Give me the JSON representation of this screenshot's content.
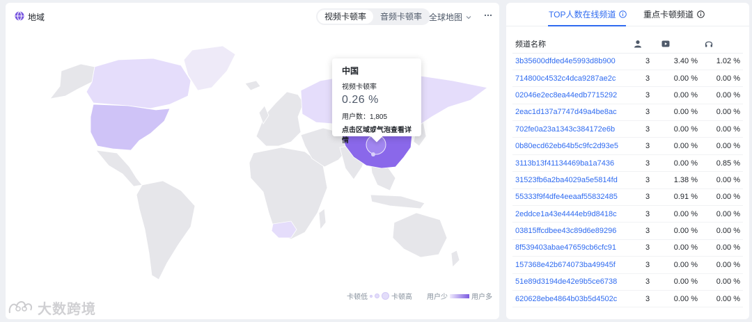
{
  "map_panel": {
    "title": "地域",
    "title_icon": "globe-icon",
    "toggle": {
      "options": [
        "视频卡顿率",
        "音频卡顿率"
      ],
      "selected": "视频卡顿率"
    },
    "map_select": {
      "value": "全球地图",
      "icon": "chevron-down-icon"
    },
    "more_icon": "more-horizontal-icon",
    "tooltip": {
      "country": "中国",
      "metric_label": "视频卡顿率",
      "metric_value": "0.26 %",
      "users_label": "用户数：",
      "users_value": "1,805",
      "hint": "点击区域或气泡查看详情"
    },
    "legend": {
      "stall_low": "卡顿低",
      "stall_high": "卡顿高",
      "users_few": "用户少",
      "users_many": "用户多"
    },
    "highlighted_regions": [
      "China",
      "Russia",
      "United States",
      "Canada",
      "Greenland",
      "South Africa"
    ],
    "colors": {
      "accent": "#2f6bf0",
      "highlight_strong": "#8d6cec",
      "highlight_light": "#d9d0fb",
      "land": "#e6e6ea"
    }
  },
  "watermark": {
    "text": "大数跨境"
  },
  "channel_panel": {
    "tabs": [
      {
        "label": "TOP人数在线频道",
        "active": true,
        "icon": "info-icon"
      },
      {
        "label": "重点卡顿频道",
        "active": false,
        "icon": "info-icon"
      }
    ],
    "columns": {
      "name": "频道名称",
      "users_icon": "user-icon",
      "video_icon": "video-play-icon",
      "audio_icon": "headphones-icon"
    },
    "rows": [
      {
        "name": "3b35600dfded4e5993d8b900",
        "users": "3",
        "video": "3.40 %",
        "audio": "1.02 %"
      },
      {
        "name": "714800c4532c4dca9287ae2c",
        "users": "3",
        "video": "0.00 %",
        "audio": "0.00 %"
      },
      {
        "name": "02046e2ec8ea44edb7715292",
        "users": "3",
        "video": "0.00 %",
        "audio": "0.00 %"
      },
      {
        "name": "2eac1d137a7747d49a4be8ac",
        "users": "3",
        "video": "0.00 %",
        "audio": "0.00 %"
      },
      {
        "name": "702fe0a23a1343c384172e6b",
        "users": "3",
        "video": "0.00 %",
        "audio": "0.00 %"
      },
      {
        "name": "0b80ecd62eb64b5c9fc2d93e5",
        "users": "3",
        "video": "0.00 %",
        "audio": "0.00 %"
      },
      {
        "name": "3113b13f41134469ba1a7436",
        "users": "3",
        "video": "0.00 %",
        "audio": "0.85 %"
      },
      {
        "name": "31523fb6a2ba4029a5e5814fd",
        "users": "3",
        "video": "1.38 %",
        "audio": "0.00 %"
      },
      {
        "name": "55333f9f4dfe4eeaaf55832485",
        "users": "3",
        "video": "0.91 %",
        "audio": "0.00 %"
      },
      {
        "name": "2eddce1a43e4444eb9d8418c",
        "users": "3",
        "video": "0.00 %",
        "audio": "0.00 %"
      },
      {
        "name": "03815ffcdbee43c89d6e89296",
        "users": "3",
        "video": "0.00 %",
        "audio": "0.00 %"
      },
      {
        "name": "8f539403abae47659cb6cfc91",
        "users": "3",
        "video": "0.00 %",
        "audio": "0.00 %"
      },
      {
        "name": "157368e42b674073ba49945f",
        "users": "3",
        "video": "0.00 %",
        "audio": "0.00 %"
      },
      {
        "name": "51e89d3194de42e9b5ce6738",
        "users": "3",
        "video": "0.00 %",
        "audio": "0.00 %"
      },
      {
        "name": "620628ebe4864b03b5d4502c",
        "users": "3",
        "video": "0.00 %",
        "audio": "0.00 %"
      }
    ]
  }
}
